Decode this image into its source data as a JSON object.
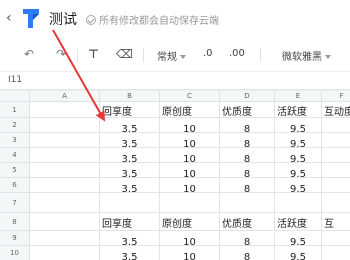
{
  "app": {
    "back_icon": "chevron-left-icon",
    "logo_icon": "docs-logo-icon",
    "title": "测试",
    "save_status": "所有修改都会自动保存云端"
  },
  "toolbar": {
    "format_label": "常规",
    "decimal_inc": ".0",
    "decimal_dec": ".00",
    "font_name": "微软雅黑"
  },
  "formula_bar": {
    "cell_ref": "I11"
  },
  "grid": {
    "columns": [
      "A",
      "B",
      "C",
      "D",
      "E",
      "F"
    ],
    "rows": [
      "1",
      "2",
      "3",
      "4",
      "5",
      "6",
      "7",
      "8",
      "9",
      "10"
    ],
    "row1": [
      "",
      "回享度",
      "原创度",
      "优质度",
      "活跃度",
      "互动度"
    ],
    "r2": [
      "",
      "3.5",
      "10",
      "8",
      "9.5",
      ""
    ],
    "r3": [
      "",
      "3.5",
      "10",
      "8",
      "9.5",
      ""
    ],
    "r4": [
      "",
      "3.5",
      "10",
      "8",
      "9.5",
      ""
    ],
    "r5": [
      "",
      "3.5",
      "10",
      "8",
      "9.5",
      ""
    ],
    "r6": [
      "",
      "3.5",
      "10",
      "8",
      "9.5",
      ""
    ],
    "r7": [
      "",
      "",
      "",
      "",
      "",
      ""
    ],
    "row8": [
      "",
      "回享度",
      "原创度",
      "优质度",
      "活跃度",
      "互"
    ],
    "r9": [
      "",
      "3.5",
      "10",
      "8",
      "9.5",
      ""
    ],
    "r10": [
      "",
      "3.5",
      "10",
      "8",
      "9.5",
      ""
    ]
  },
  "colors": {
    "accent": "#2b7cf6",
    "arrow": "#e53935"
  }
}
